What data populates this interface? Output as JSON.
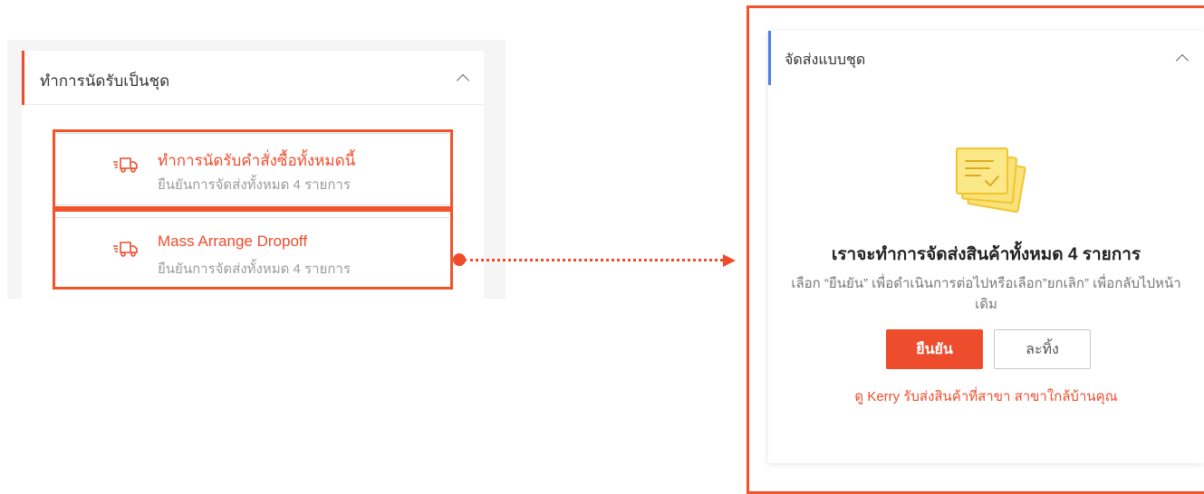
{
  "left_panel": {
    "title": "ทำการนัดรับเป็นชุด",
    "options": [
      {
        "title": "ทำการนัดรับคำสั่งซื้อทั้งหมดนี้",
        "subtitle": "ยืนยันการจัดส่งทั้งหมด 4 รายการ"
      },
      {
        "title": "Mass Arrange Dropoff",
        "subtitle": "ยืนยันการจัดส่งทั้งหมด 4 รายการ"
      }
    ]
  },
  "right_panel": {
    "title": "จัดส่งแบบชุด",
    "confirm_title": "เราจะทำการจัดส่งสินค้าทั้งหมด 4 รายการ",
    "confirm_description": "เลือก “ยืนยัน” เพื่อดำเนินการต่อไปหรือเลือก”ยกเลิก” เพื่อกลับไปหน้าเดิม",
    "confirm_button": "ยืนยัน",
    "cancel_button": "ละทิ้ง",
    "link_text": "ดู Kerry รับส่งสินค้าที่สาขา สาขาใกล้บ้านคุณ"
  },
  "icons": {
    "option_icon": "truck-icon",
    "collapse_icon": "chevron-up-icon",
    "illustration": "documents-check-icon"
  },
  "colors": {
    "accent": "#ee4d2d",
    "highlight": "#f0542a",
    "header_accent_blue": "#4a7fe8",
    "doc_yellow": "#f5d442"
  }
}
